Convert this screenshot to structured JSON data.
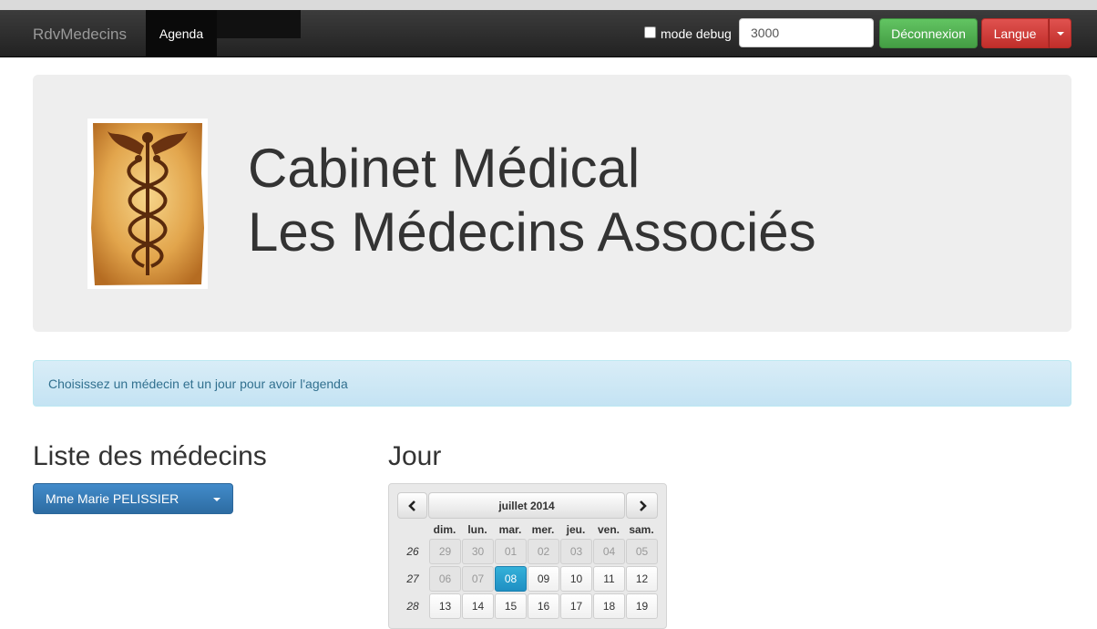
{
  "navbar": {
    "brand": "RdvMedecins",
    "active_tab": "Agenda",
    "debug_label": "mode debug",
    "delay_value": "3000",
    "logout_label": "Déconnexion",
    "language_label": "Langue"
  },
  "jumbotron": {
    "title_line1": "Cabinet Médical",
    "title_line2": "Les Médecins Associés"
  },
  "alert": {
    "message": "Choisissez un médecin et un jour pour avoir l'agenda"
  },
  "doctors": {
    "heading": "Liste des médecins",
    "selected": "Mme Marie PELISSIER"
  },
  "calendar": {
    "heading": "Jour",
    "month_label": "juillet 2014",
    "prev_icon": "chevron-left-icon",
    "next_icon": "chevron-right-icon",
    "weekdays": [
      "dim.",
      "lun.",
      "mar.",
      "mer.",
      "jeu.",
      "ven.",
      "sam."
    ],
    "weeks": [
      {
        "num": "26",
        "days": [
          "29",
          "30",
          "01",
          "02",
          "03",
          "04",
          "05"
        ]
      },
      {
        "num": "27",
        "days": [
          "06",
          "07",
          "08",
          "09",
          "10",
          "11",
          "12"
        ]
      },
      {
        "num": "28",
        "days": [
          "13",
          "14",
          "15",
          "16",
          "17",
          "18",
          "19"
        ]
      }
    ],
    "selected_day": "08"
  },
  "colors": {
    "logout_button": "#5cb85c",
    "language_button": "#d9534f",
    "doctor_select": "#428bca",
    "selected_day": "#2aa3d2",
    "alert_bg": "#d9edf7"
  }
}
